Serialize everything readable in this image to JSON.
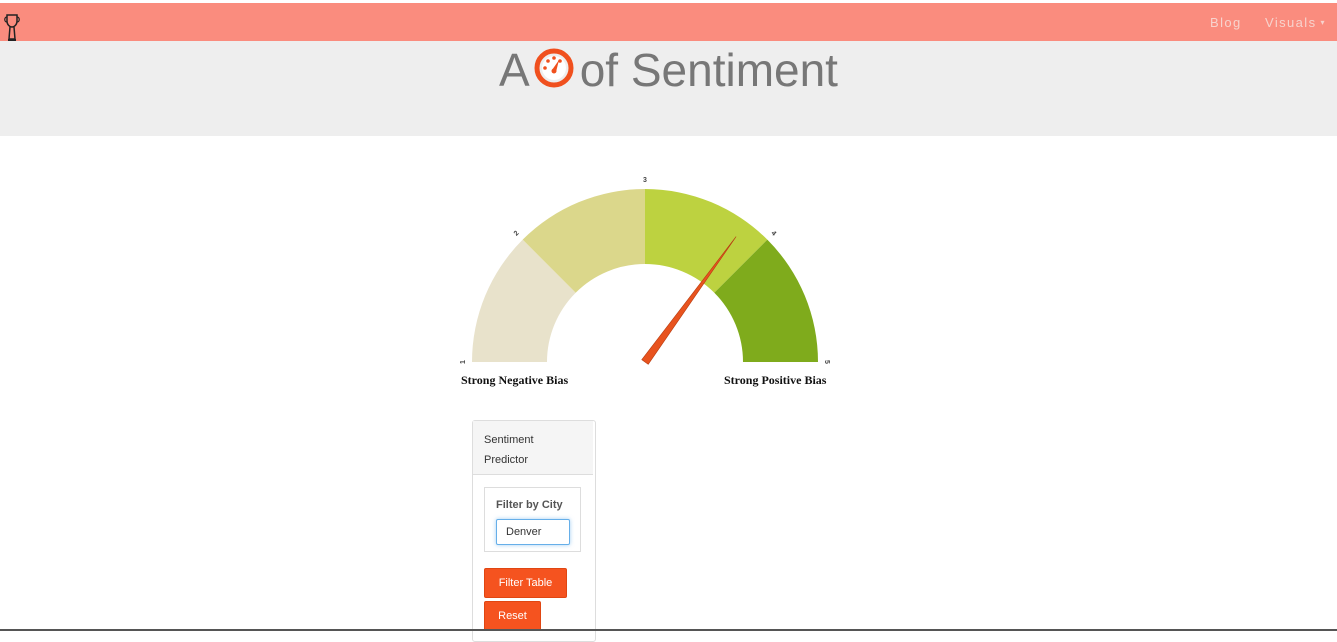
{
  "navbar": {
    "brand_icon": "trophy-icon",
    "links": [
      {
        "label": "Blog"
      },
      {
        "label": "Visuals",
        "caret": "▾"
      }
    ]
  },
  "header": {
    "title_prefix": "A",
    "title_icon": "dashboard-gauge-icon",
    "title_suffix": "of Sentiment"
  },
  "gauge": {
    "min": 1,
    "max": 5,
    "value": 3.8,
    "ticks": [
      "1",
      "2",
      "3",
      "4",
      "5"
    ],
    "bands": [
      {
        "from": 1,
        "to": 2,
        "color": "#e8e2cb"
      },
      {
        "from": 2,
        "to": 3,
        "color": "#dbd78b"
      },
      {
        "from": 3,
        "to": 4,
        "color": "#bdd240"
      },
      {
        "from": 4,
        "to": 5,
        "color": "#7fab1c"
      }
    ],
    "needle_color": "#e8531e",
    "left_label": "Strong Negative Bias",
    "right_label": "Strong Positive Bias"
  },
  "panel": {
    "heading_line1": "Sentiment",
    "heading_line2": "Predictor",
    "filter_label": "Filter by City",
    "city_value": "Denver",
    "filter_button": "Filter Table",
    "reset_button": "Reset"
  },
  "colors": {
    "navbar": "#fa8c7e",
    "accent": "#f5531f",
    "jumbotron": "#eeeeee"
  }
}
